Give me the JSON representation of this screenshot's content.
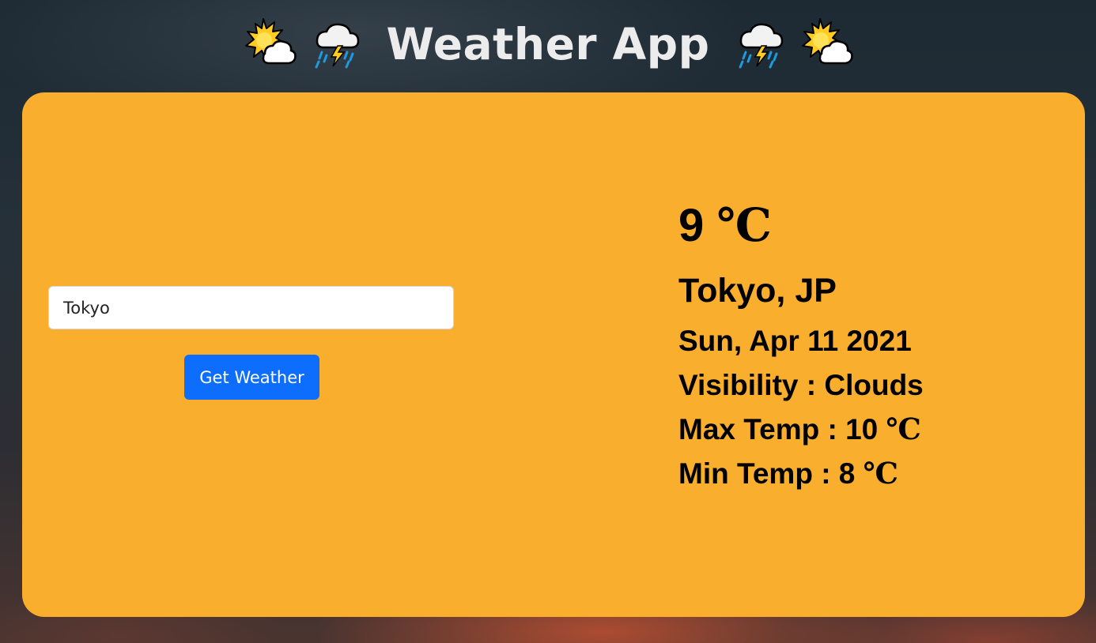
{
  "header": {
    "title": "Weather App",
    "icons": [
      "sun-behind-cloud-icon",
      "cloud-with-lightning-and-rain-icon",
      "cloud-with-lightning-and-rain-icon",
      "sun-behind-cloud-icon"
    ]
  },
  "search": {
    "value": "Tokyo",
    "button_label": "Get Weather"
  },
  "weather": {
    "temperature": "9",
    "temperature_unit": "℃",
    "location": "Tokyo, JP",
    "date": "Sun, Apr 11 2021",
    "visibility_label": "Visibility : ",
    "visibility_value": "Clouds",
    "max_temp_label": "Max Temp : ",
    "max_temp_value": "10",
    "min_temp_label": "Min Temp : ",
    "min_temp_value": "8",
    "unit": "℃"
  },
  "colors": {
    "card_background": "#f9ae2d",
    "button_background": "#0d6efd",
    "title_color": "#ececec"
  }
}
